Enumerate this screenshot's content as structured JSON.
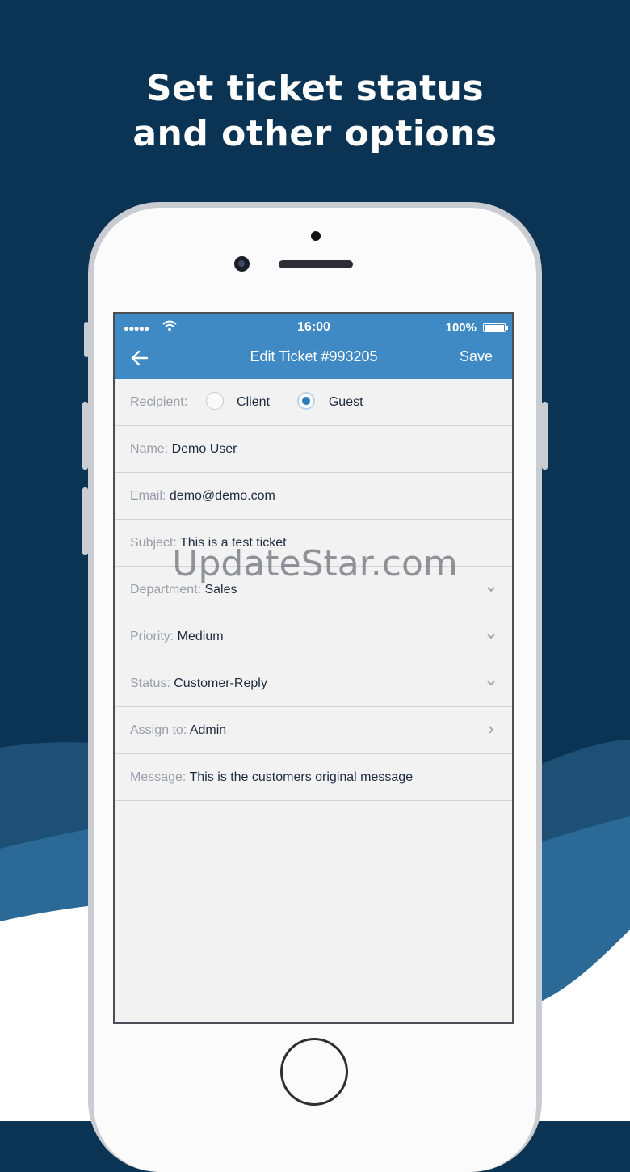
{
  "headline": {
    "line1": "Set ticket status",
    "line2": "and other options"
  },
  "status_bar": {
    "time": "16:00",
    "battery": "100%",
    "signal": "●●●●●"
  },
  "nav": {
    "title": "Edit Ticket #993205",
    "save_label": "Save"
  },
  "form": {
    "recipient": {
      "label": "Recipient:",
      "options": [
        "Client",
        "Guest"
      ],
      "selected": "Guest"
    },
    "name": {
      "label": "Name:",
      "value": "Demo User"
    },
    "email": {
      "label": "Email:",
      "value": "demo@demo.com"
    },
    "subject": {
      "label": "Subject:",
      "value": "This is a test ticket"
    },
    "department": {
      "label": "Department:",
      "value": "Sales"
    },
    "priority": {
      "label": "Priority:",
      "value": "Medium"
    },
    "status": {
      "label": "Status:",
      "value": "Customer-Reply"
    },
    "assign": {
      "label": "Assign to:",
      "value": "Admin"
    },
    "message": {
      "label": "Message:",
      "value": "This is the customers original message"
    }
  },
  "watermark": "UpdateStar.com",
  "colors": {
    "background": "#0b3454",
    "nav_bar": "#3f8ac4",
    "radio_selected": "#2f7fc0",
    "wave_light": "#2b6a96",
    "wave_dark": "#1e4f75"
  }
}
